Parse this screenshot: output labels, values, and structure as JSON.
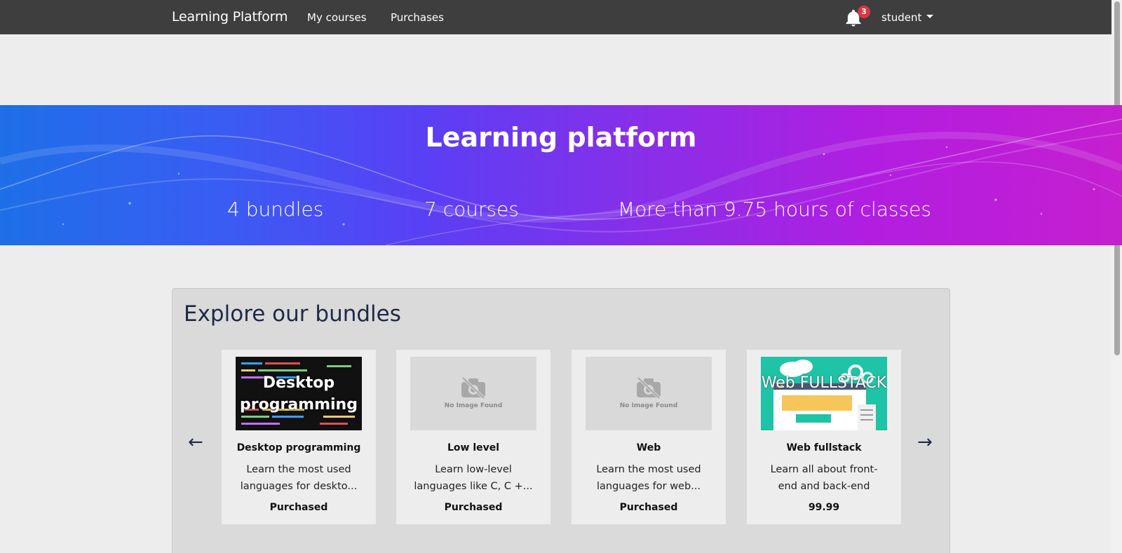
{
  "nav": {
    "brand": "Learning Platform",
    "links": [
      "My courses",
      "Purchases"
    ],
    "notifications_count": "3",
    "user": "student"
  },
  "hero": {
    "title": "Learning platform",
    "stats": [
      "4 bundles",
      "7 courses",
      "More than 9.75 hours of classes"
    ]
  },
  "bundles": {
    "title": "Explore our bundles",
    "prev_arrow": "←",
    "next_arrow": "→",
    "items": [
      {
        "image_label": "Desktop programming",
        "title": "Desktop programming",
        "description": "Learn the most used languages for deskto...",
        "price": "Purchased"
      },
      {
        "image_label": "No Image Found",
        "title": "Low level",
        "description": "Learn low-level languages like C, C +...",
        "price": "Purchased"
      },
      {
        "image_label": "No Image Found",
        "title": "Web",
        "description": "Learn the most used languages for web...",
        "price": "Purchased"
      },
      {
        "image_label": "Web FULLSTACK",
        "title": "Web fullstack",
        "description": "Learn all about front-end and back-end",
        "price": "99.99"
      }
    ]
  },
  "colors": {
    "navbar": "#3e3e3f",
    "hero_start": "#1e6fe8",
    "hero_end": "#c51fcf",
    "panel": "#dadada",
    "heading": "#1e2a44",
    "badge": "#dc3545"
  }
}
